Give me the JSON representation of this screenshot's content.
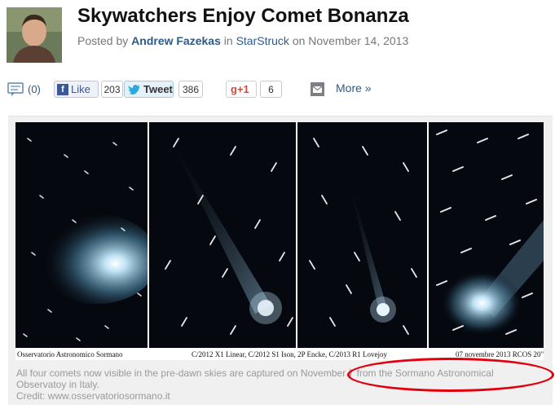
{
  "header": {
    "title": "Skywatchers Enjoy Comet Bonanza",
    "posted_by": "Posted by",
    "author": "Andrew Fazekas",
    "in_text": "in",
    "blog": "StarStruck",
    "on_text": "on November 14, 2013"
  },
  "social": {
    "comments": "(0)",
    "like_label": "Like",
    "like_count": "203",
    "tweet_label": "Tweet",
    "tweet_count": "386",
    "gplus_label": "+1",
    "gplus_count": "6",
    "more_label": "More »"
  },
  "figure": {
    "credits": {
      "left": "Osservatorio Astronomico  Sormano",
      "middle": "C/2012 X1 Linear, C/2012 S1 Ison, 2P Encke, C/2013 R1 Lovejoy",
      "right": "07 novembre 2013  RCOS 20\""
    },
    "caption_1": "All four comets now visible in the pre-dawn skies are captured on November 7 from the Sormano Astronomical Observatoy in Italy.",
    "caption_2": "Credit: www.osservatoriosormano.it"
  },
  "colors": {
    "link": "#2e5a8a",
    "annotation": "#e2000e",
    "sky": "#05080f",
    "comet": "#bfe3f5"
  }
}
